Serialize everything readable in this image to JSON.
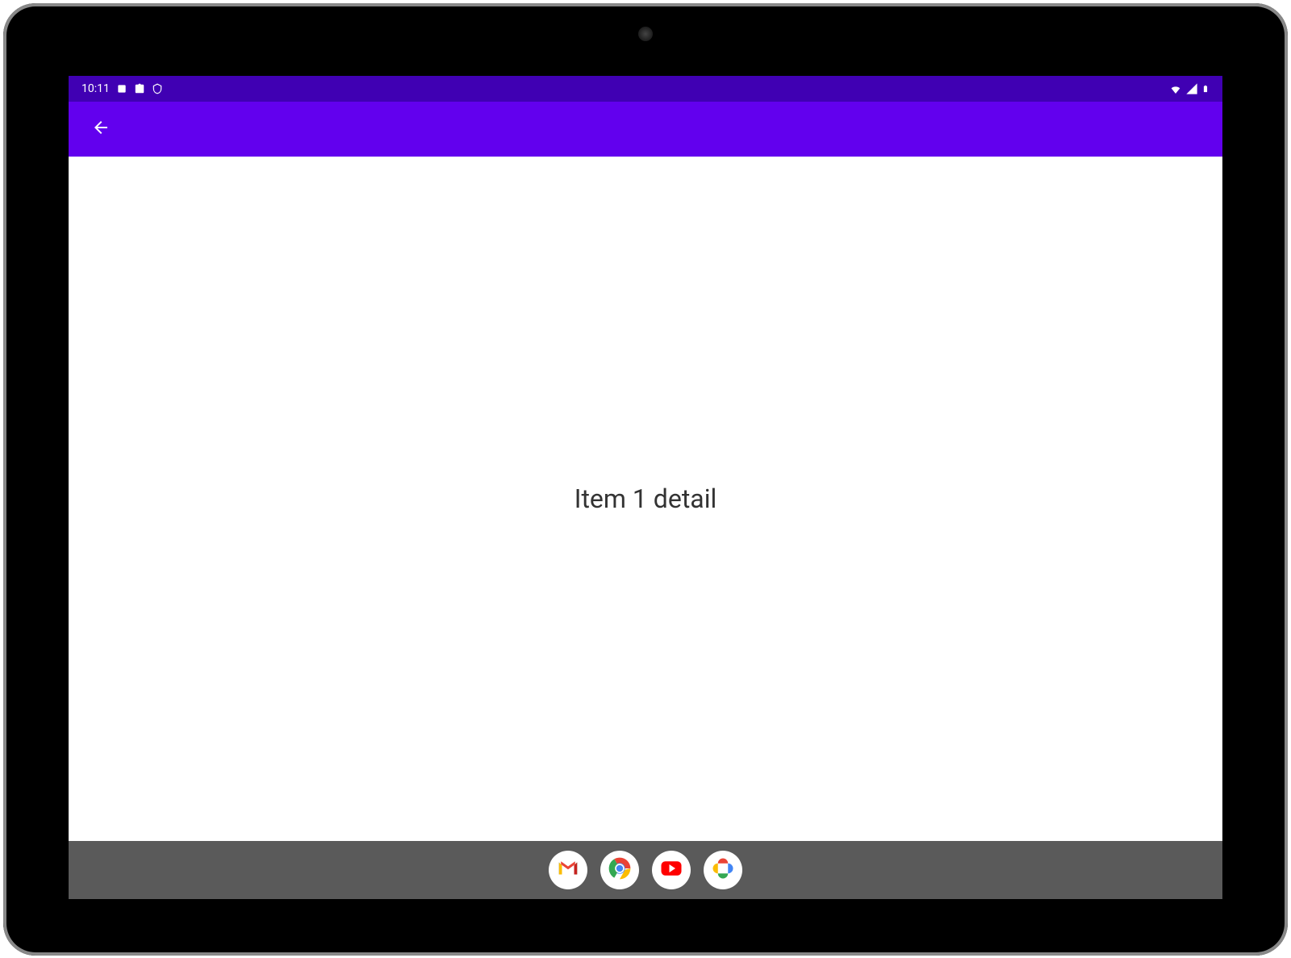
{
  "status_bar": {
    "time": "10:11",
    "icons": {
      "left": [
        "app-icon",
        "clipboard-icon",
        "shield-icon"
      ],
      "right": [
        "wifi-icon",
        "signal-icon",
        "battery-icon"
      ]
    }
  },
  "app_bar": {
    "back_icon": "arrow-back-icon"
  },
  "content": {
    "detail_text": "Item 1 detail"
  },
  "taskbar": {
    "apps": [
      {
        "name": "gmail",
        "label": "Gmail"
      },
      {
        "name": "chrome",
        "label": "Chrome"
      },
      {
        "name": "youtube",
        "label": "YouTube"
      },
      {
        "name": "photos",
        "label": "Photos"
      }
    ]
  },
  "colors": {
    "status_bar_bg": "#4000b3",
    "app_bar_bg": "#6200ee",
    "content_bg": "#ffffff",
    "taskbar_bg": "#5a5a5a"
  }
}
